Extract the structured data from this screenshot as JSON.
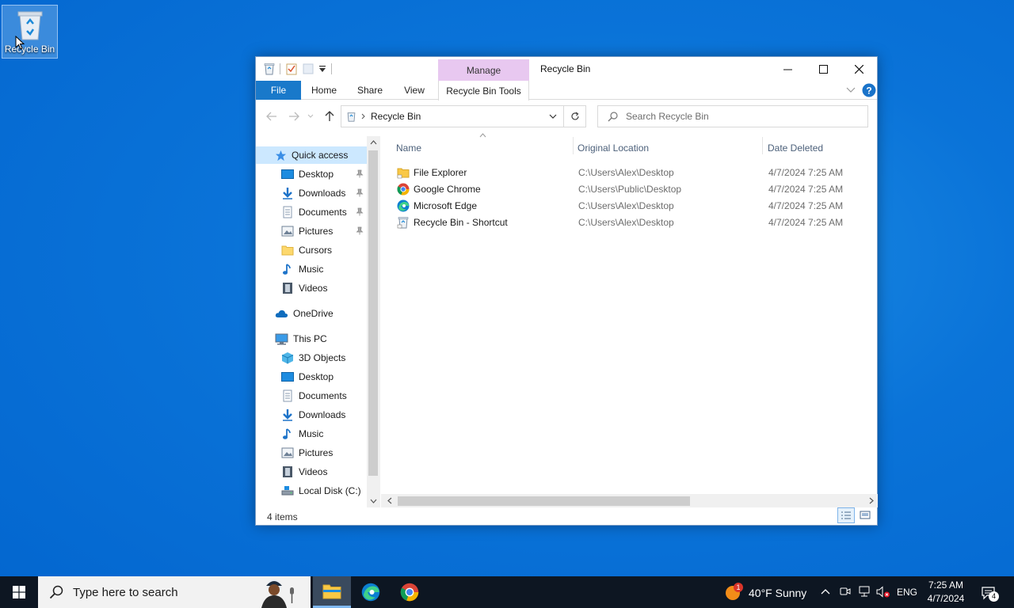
{
  "desktop": {
    "recycle_bin_label": "Recycle Bin"
  },
  "window": {
    "title": "Recycle Bin",
    "contextual_tab_group": "Manage",
    "ribbon_tabs": [
      "File",
      "Home",
      "Share",
      "View",
      "Recycle Bin Tools"
    ],
    "address": {
      "path": "Recycle Bin"
    },
    "search": {
      "placeholder": "Search Recycle Bin"
    },
    "nav": {
      "quick_access": "Quick access",
      "quick_items": [
        "Desktop",
        "Downloads",
        "Documents",
        "Pictures",
        "Cursors",
        "Music",
        "Videos"
      ],
      "onedrive": "OneDrive",
      "this_pc": "This PC",
      "pc_items": [
        "3D Objects",
        "Desktop",
        "Documents",
        "Downloads",
        "Music",
        "Pictures",
        "Videos",
        "Local Disk (C:)"
      ]
    },
    "columns": {
      "name": "Name",
      "location": "Original Location",
      "date": "Date Deleted"
    },
    "files": [
      {
        "name": "File Explorer",
        "location": "C:\\Users\\Alex\\Desktop",
        "date": "4/7/2024 7:25 AM"
      },
      {
        "name": "Google Chrome",
        "location": "C:\\Users\\Public\\Desktop",
        "date": "4/7/2024 7:25 AM"
      },
      {
        "name": "Microsoft Edge",
        "location": "C:\\Users\\Alex\\Desktop",
        "date": "4/7/2024 7:25 AM"
      },
      {
        "name": "Recycle Bin - Shortcut",
        "location": "C:\\Users\\Alex\\Desktop",
        "date": "4/7/2024 7:25 AM"
      }
    ],
    "status": "4 items"
  },
  "taskbar": {
    "search_placeholder": "Type here to search",
    "weather": "40°F  Sunny",
    "weather_badge": "1",
    "language": "ENG",
    "time": "7:25 AM",
    "date": "4/7/2024",
    "notification_count": "4"
  },
  "colors": {
    "accent": "#1979ca",
    "desktop": "#0a73d8",
    "manage_tab": "#e8c8f0",
    "nav_selected": "#cce8ff"
  }
}
